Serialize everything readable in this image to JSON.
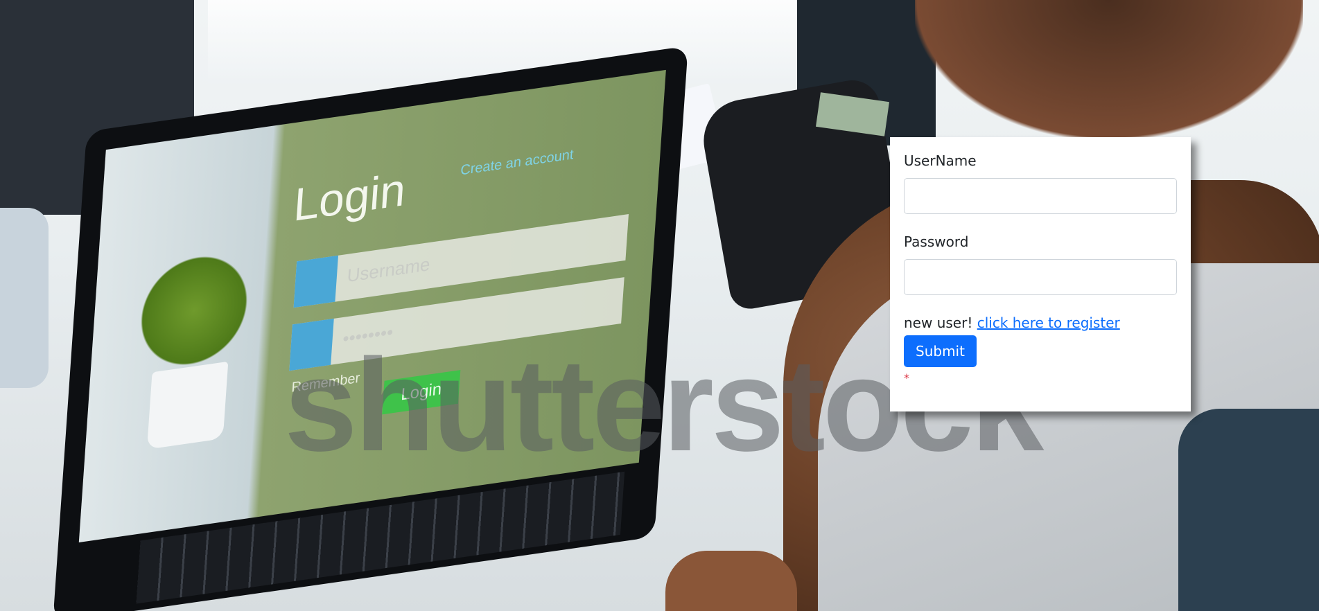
{
  "background": {
    "description_icon": "stock-photo-background",
    "laptop_screen": {
      "title": "Login",
      "create_account": "Create an account",
      "username_placeholder": "Username",
      "password_mask": "••••••••",
      "remember": "Remember",
      "button": "Login"
    },
    "watermark": "shutterstock"
  },
  "login_form": {
    "username_label": "UserName",
    "username_value": "",
    "password_label": "Password",
    "password_value": "",
    "register_prefix": "new user!",
    "register_link": "click here to register",
    "submit_label": "Submit",
    "required_marker": "*"
  },
  "colors": {
    "primary": "#0d6efd",
    "danger": "#dc3545",
    "card_bg": "#ffffff"
  }
}
